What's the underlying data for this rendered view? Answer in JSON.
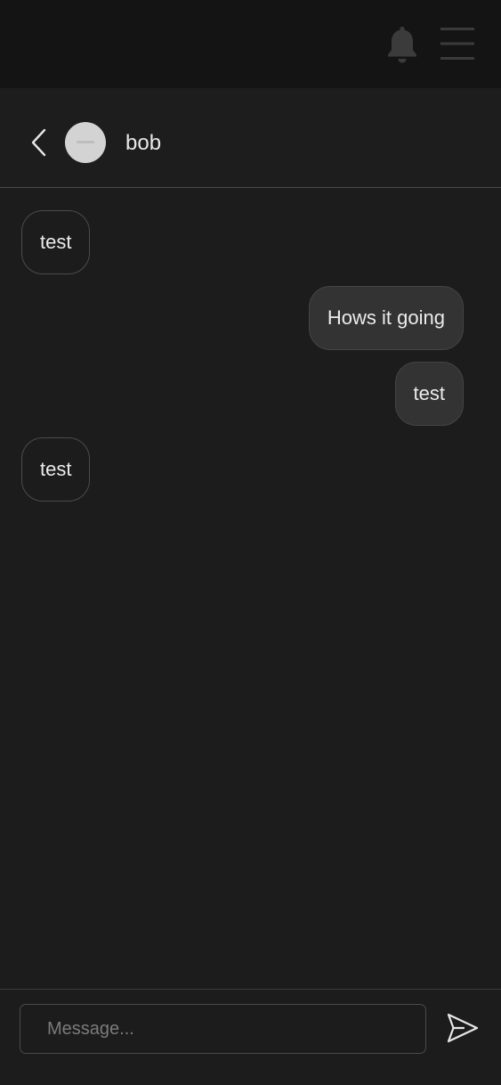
{
  "topbar": {
    "bell_icon": "bell-icon",
    "menu_icon": "hamburger-menu-icon"
  },
  "chat_header": {
    "back_icon": "chevron-left-icon",
    "contact_name": "bob"
  },
  "messages": [
    {
      "text": "test",
      "direction": "received"
    },
    {
      "text": "Hows it going",
      "direction": "sent"
    },
    {
      "text": "test",
      "direction": "sent"
    },
    {
      "text": "test",
      "direction": "received"
    }
  ],
  "composer": {
    "placeholder": "Message...",
    "value": "",
    "send_icon": "send-icon"
  },
  "colors": {
    "background": "#1c1c1c",
    "topbar": "#141414",
    "sent_bubble": "#333333",
    "received_border": "#4b4b4b",
    "text": "#ececec"
  }
}
